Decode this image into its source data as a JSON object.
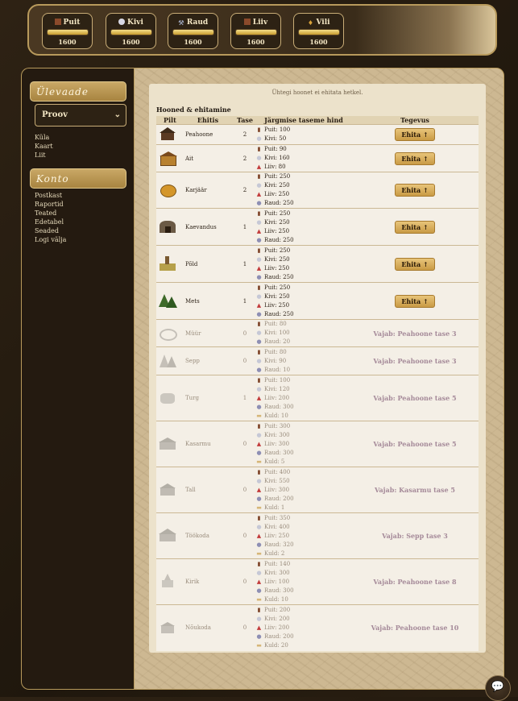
{
  "resources": [
    {
      "name": "Puit",
      "value": "1600",
      "icon": "wood-icon",
      "fill": 1.0,
      "color": "#8b4a2b"
    },
    {
      "name": "Kivi",
      "value": "1600",
      "icon": "stone-icon",
      "fill": 1.0,
      "color": "#d8d8e4"
    },
    {
      "name": "Raud",
      "value": "1600",
      "icon": "iron-icon",
      "fill": 1.0,
      "color": "#9aa2b8"
    },
    {
      "name": "Liiv",
      "value": "1600",
      "icon": "sand-icon",
      "fill": 1.0,
      "color": "#8b4a2b"
    },
    {
      "name": "Vili",
      "value": "1600",
      "icon": "grain-icon",
      "fill": 1.0,
      "color": "#d9a23a"
    }
  ],
  "sidebar": {
    "overview_title": "Ülevaade",
    "village_selected": "Proov",
    "overview_links": [
      "Küla",
      "Kaart",
      "Liit"
    ],
    "account_title": "Konto",
    "account_links": [
      "Postkast",
      "Raportid",
      "Teated",
      "Edetabel",
      "Seaded",
      "Logi välja"
    ]
  },
  "main": {
    "notice": "Ühtegi hoonet ei ehitata hetkel.",
    "section_title": "Hooned & ehitamine",
    "columns": [
      "Pilt",
      "Ehitis",
      "Tase",
      "Järgmise taseme hind",
      "Tegevus"
    ],
    "build_label": "Ehita ↑"
  },
  "buildings": [
    {
      "name": "Peahoone",
      "level": "2",
      "icon": "town-hall-icon",
      "locked": false,
      "costs": [
        {
          "res": "wood",
          "text": "Puit: 100"
        },
        {
          "res": "stone",
          "text": "Kivi: 50"
        }
      ]
    },
    {
      "name": "Ait",
      "level": "2",
      "icon": "warehouse-icon",
      "locked": false,
      "costs": [
        {
          "res": "wood",
          "text": "Puit: 90"
        },
        {
          "res": "stone",
          "text": "Kivi: 160"
        },
        {
          "res": "sand",
          "text": "Liiv: 80"
        }
      ]
    },
    {
      "name": "Karjäär",
      "level": "2",
      "icon": "quarry-icon",
      "locked": false,
      "costs": [
        {
          "res": "wood",
          "text": "Puit: 250"
        },
        {
          "res": "stone",
          "text": "Kivi: 250"
        },
        {
          "res": "sand",
          "text": "Liiv: 250"
        },
        {
          "res": "iron",
          "text": "Raud: 250"
        }
      ]
    },
    {
      "name": "Kaevandus",
      "level": "1",
      "icon": "mine-icon",
      "locked": false,
      "costs": [
        {
          "res": "wood",
          "text": "Puit: 250"
        },
        {
          "res": "stone",
          "text": "Kivi: 250"
        },
        {
          "res": "sand",
          "text": "Liiv: 250"
        },
        {
          "res": "iron",
          "text": "Raud: 250"
        }
      ]
    },
    {
      "name": "Põld",
      "level": "1",
      "icon": "farm-field-icon",
      "locked": false,
      "costs": [
        {
          "res": "wood",
          "text": "Puit: 250"
        },
        {
          "res": "stone",
          "text": "Kivi: 250"
        },
        {
          "res": "sand",
          "text": "Liiv: 250"
        },
        {
          "res": "iron",
          "text": "Raud: 250"
        }
      ]
    },
    {
      "name": "Mets",
      "level": "1",
      "icon": "forest-icon",
      "locked": false,
      "costs": [
        {
          "res": "wood",
          "text": "Puit: 250"
        },
        {
          "res": "stone",
          "text": "Kivi: 250"
        },
        {
          "res": "sand",
          "text": "Liiv: 250"
        },
        {
          "res": "iron",
          "text": "Raud: 250"
        }
      ]
    },
    {
      "name": "Müür",
      "level": "0",
      "icon": "wall-icon",
      "locked": true,
      "requirement": "Vajab: Peahoone tase 3",
      "costs": [
        {
          "res": "wood",
          "text": "Puit: 80"
        },
        {
          "res": "stone",
          "text": "Kivi: 100"
        },
        {
          "res": "iron",
          "text": "Raud: 20"
        }
      ]
    },
    {
      "name": "Sepp",
      "level": "0",
      "icon": "smithy-icon",
      "locked": true,
      "requirement": "Vajab: Peahoone tase 3",
      "costs": [
        {
          "res": "wood",
          "text": "Puit: 80"
        },
        {
          "res": "stone",
          "text": "Kivi: 90"
        },
        {
          "res": "iron",
          "text": "Raud: 10"
        }
      ]
    },
    {
      "name": "Turg",
      "level": "1",
      "icon": "market-icon",
      "locked": true,
      "requirement": "Vajab: Peahoone tase 5",
      "costs": [
        {
          "res": "wood",
          "text": "Puit: 100"
        },
        {
          "res": "stone",
          "text": "Kivi: 120"
        },
        {
          "res": "sand",
          "text": "Liiv: 200"
        },
        {
          "res": "iron",
          "text": "Raud: 300"
        },
        {
          "res": "gold",
          "text": "Kuld: 10"
        }
      ]
    },
    {
      "name": "Kasarmu",
      "level": "0",
      "icon": "barracks-icon",
      "locked": true,
      "requirement": "Vajab: Peahoone tase 5",
      "costs": [
        {
          "res": "wood",
          "text": "Puit: 300"
        },
        {
          "res": "stone",
          "text": "Kivi: 300"
        },
        {
          "res": "sand",
          "text": "Liiv: 300"
        },
        {
          "res": "iron",
          "text": "Raud: 300"
        },
        {
          "res": "gold",
          "text": "Kuld: 5"
        }
      ]
    },
    {
      "name": "Tall",
      "level": "0",
      "icon": "stable-icon",
      "locked": true,
      "requirement": "Vajab: Kasarmu tase 5",
      "costs": [
        {
          "res": "wood",
          "text": "Puit: 400"
        },
        {
          "res": "stone",
          "text": "Kivi: 550"
        },
        {
          "res": "sand",
          "text": "Liiv: 300"
        },
        {
          "res": "iron",
          "text": "Raud: 200"
        },
        {
          "res": "gold",
          "text": "Kuld: 1"
        }
      ]
    },
    {
      "name": "Töökoda",
      "level": "0",
      "icon": "workshop-icon",
      "locked": true,
      "requirement": "Vajab: Sepp tase 3",
      "costs": [
        {
          "res": "wood",
          "text": "Puit: 350"
        },
        {
          "res": "stone",
          "text": "Kivi: 400"
        },
        {
          "res": "sand",
          "text": "Liiv: 250"
        },
        {
          "res": "iron",
          "text": "Raud: 320"
        },
        {
          "res": "gold",
          "text": "Kuld: 2"
        }
      ]
    },
    {
      "name": "Kirik",
      "level": "0",
      "icon": "church-icon",
      "locked": true,
      "requirement": "Vajab: Peahoone tase 8",
      "costs": [
        {
          "res": "wood",
          "text": "Puit: 140"
        },
        {
          "res": "stone",
          "text": "Kivi: 300"
        },
        {
          "res": "sand",
          "text": "Liiv: 100"
        },
        {
          "res": "iron",
          "text": "Raud: 300"
        },
        {
          "res": "gold",
          "text": "Kuld: 10"
        }
      ]
    },
    {
      "name": "Nõukoda",
      "level": "0",
      "icon": "council-hall-icon",
      "locked": true,
      "requirement": "Vajab: Peahoone tase 10",
      "costs": [
        {
          "res": "wood",
          "text": "Puit: 200"
        },
        {
          "res": "stone",
          "text": "Kivi: 200"
        },
        {
          "res": "sand",
          "text": "Liiv: 200"
        },
        {
          "res": "iron",
          "text": "Raud: 200"
        },
        {
          "res": "gold",
          "text": "Kuld: 20"
        }
      ]
    }
  ],
  "chat_icon": "chat-bubble-icon"
}
